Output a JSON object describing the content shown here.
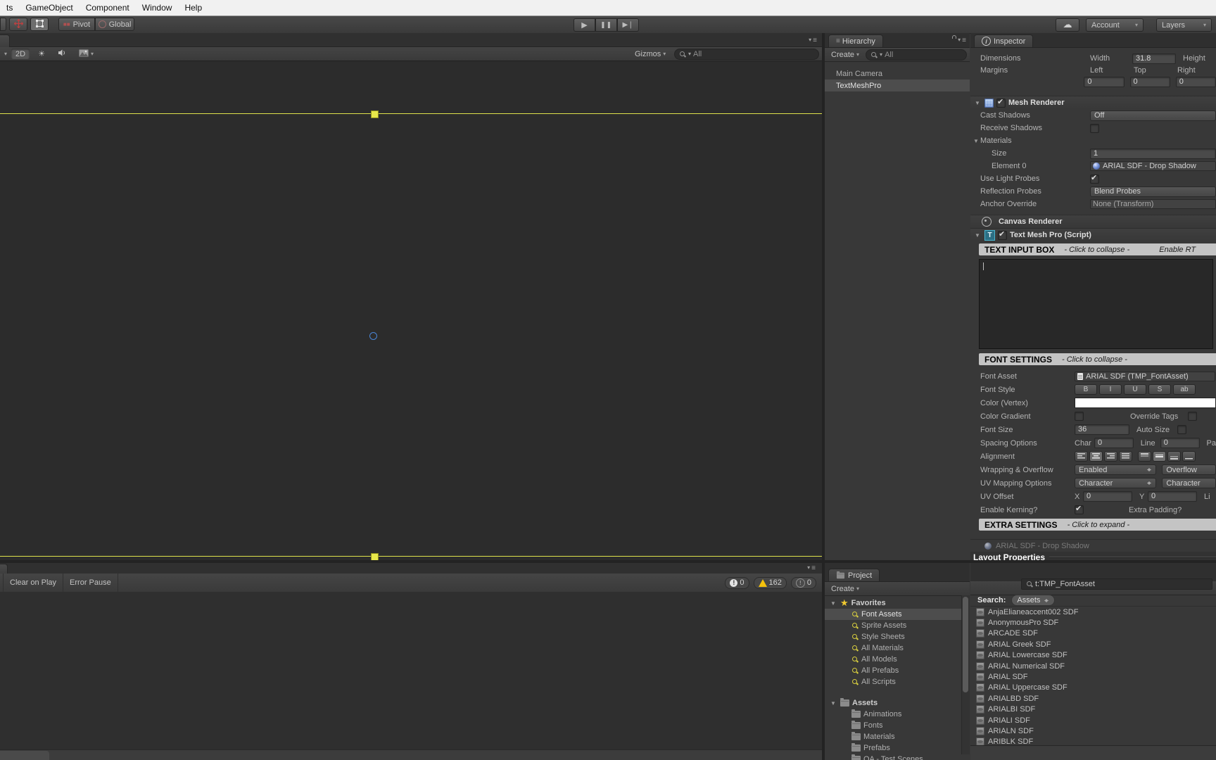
{
  "menu": {
    "items": [
      "ts",
      "GameObject",
      "Component",
      "Window",
      "Help"
    ]
  },
  "toolbar": {
    "pivot": "Pivot",
    "global": "Global",
    "account": "Account",
    "layers": "Layers"
  },
  "scene": {
    "mode_2d": "2D",
    "gizmos": "Gizmos",
    "search": "All"
  },
  "hierarchy": {
    "tab": "Hierarchy",
    "create": "Create",
    "search": "All",
    "items": [
      {
        "label": "Main Camera",
        "selected": false
      },
      {
        "label": "TextMeshPro",
        "selected": true
      }
    ]
  },
  "inspector": {
    "tab": "Inspector",
    "dimensions_label": "Dimensions",
    "width_label": "Width",
    "width_value": "31.8",
    "height_label": "Height",
    "margins_label": "Margins",
    "left_label": "Left",
    "top_label": "Top",
    "right_label": "Right",
    "margin_left": "0",
    "margin_top": "0",
    "margin_right": "0",
    "mesh_renderer": {
      "title": "Mesh Renderer",
      "cast_shadows_label": "Cast Shadows",
      "cast_shadows_value": "Off",
      "receive_shadows_label": "Receive Shadows",
      "materials_label": "Materials",
      "size_label": "Size",
      "size_value": "1",
      "element0_label": "Element 0",
      "element0_value": "ARIAL SDF - Drop Shadow",
      "use_light_probes_label": "Use Light Probes",
      "reflection_probes_label": "Reflection Probes",
      "reflection_probes_value": "Blend Probes",
      "anchor_override_label": "Anchor Override",
      "anchor_override_value": "None (Transform)"
    },
    "canvas_renderer_title": "Canvas Renderer",
    "tmp": {
      "title": "Text Mesh Pro (Script)",
      "input_box_title": "TEXT INPUT BOX",
      "input_box_hint": "- Click to collapse -",
      "input_box_rtl": "Enable RT",
      "font_settings_title": "FONT SETTINGS",
      "font_settings_hint": "- Click to collapse -",
      "font_asset_label": "Font Asset",
      "font_asset_value": "ARIAL SDF (TMP_FontAsset)",
      "font_style_label": "Font Style",
      "style_buttons": [
        "B",
        "I",
        "U",
        "S",
        "ab"
      ],
      "color_label": "Color (Vertex)",
      "color_gradient_label": "Color Gradient",
      "override_tags_label": "Override Tags",
      "font_size_label": "Font Size",
      "font_size_value": "36",
      "auto_size_label": "Auto Size",
      "spacing_label": "Spacing Options",
      "char_label": "Char",
      "char_value": "0",
      "line_label": "Line",
      "line_value": "0",
      "para_label": "Pa",
      "alignment_label": "Alignment",
      "wrapping_label": "Wrapping & Overflow",
      "wrapping_value": "Enabled",
      "overflow_value": "Overflow",
      "uv_mapping_label": "UV Mapping Options",
      "uv_mapping_value": "Character",
      "uv_mapping_value2": "Character",
      "uv_offset_label": "UV Offset",
      "x_label": "X",
      "x_value": "0",
      "y_label": "Y",
      "y_value": "0",
      "line2_label": "Li",
      "kerning_label": "Enable Kerning?",
      "extra_padding_label": "Extra Padding?",
      "extra_settings_title": "EXTRA SETTINGS",
      "extra_settings_hint": "- Click to expand -"
    },
    "material_partial": "ARIAL SDF - Drop Shadow",
    "layout_properties": "Layout Properties"
  },
  "console": {
    "clear_on_play": "Clear on Play",
    "error_pause": "Error Pause",
    "error_count": "0",
    "warning_count": "162",
    "message_count": "0"
  },
  "project": {
    "tab": "Project",
    "create": "Create",
    "favorites_label": "Favorites",
    "favorites": [
      {
        "label": "Font Assets",
        "selected": true
      },
      {
        "label": "Sprite Assets",
        "selected": false
      },
      {
        "label": "Style Sheets",
        "selected": false
      },
      {
        "label": "All Materials",
        "selected": false
      },
      {
        "label": "All Models",
        "selected": false
      },
      {
        "label": "All Prefabs",
        "selected": false
      },
      {
        "label": "All Scripts",
        "selected": false
      }
    ],
    "assets_label": "Assets",
    "folders": [
      "Animations",
      "Fonts",
      "Materials",
      "Prefabs",
      "QA - Test Scenes"
    ],
    "search_query": "t:TMP_FontAsset",
    "search_label": "Search:",
    "search_scope": "Assets",
    "results": [
      "AnjaElianeaccent002 SDF",
      "AnonymousPro SDF",
      "ARCADE SDF",
      "ARIAL Greek SDF",
      "ARIAL Lowercase SDF",
      "ARIAL Numerical SDF",
      "ARIAL SDF",
      "ARIAL Uppercase SDF",
      "ARIALBD SDF",
      "ARIALBI SDF",
      "ARIALI SDF",
      "ARIALN SDF",
      "ARIBLK SDF"
    ]
  },
  "colors": {
    "accent_yellow": "#e0e24b",
    "selection_gray": "#4d4d4d",
    "warning_yellow": "#f4c20d"
  }
}
